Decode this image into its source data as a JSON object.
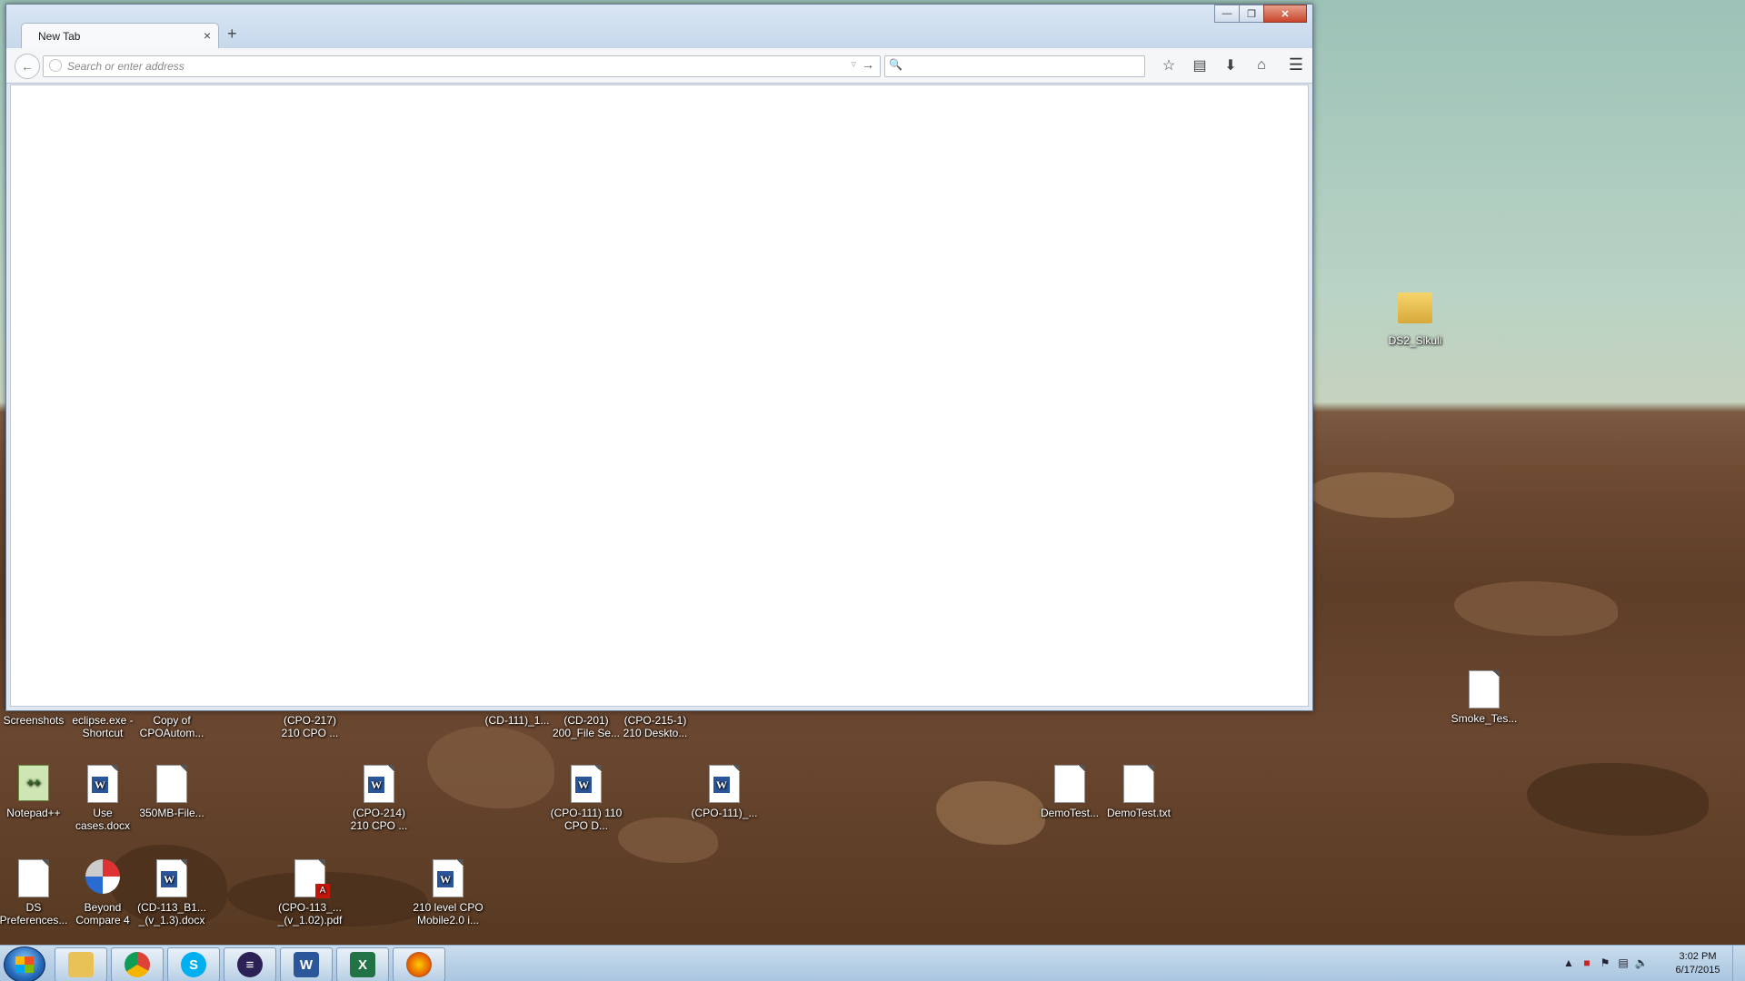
{
  "browser": {
    "tab_title": "New Tab",
    "tab_close": "×",
    "new_tab": "+",
    "url_placeholder": "Search or enter address",
    "search_placeholder": "",
    "window_controls": {
      "minimize": "—",
      "maximize": "❐",
      "close": "✕"
    }
  },
  "desktop_icons": [
    {
      "label": "Screenshots"
    },
    {
      "label": "eclipse.exe - Shortcut"
    },
    {
      "label": "Copy of CPOAutom..."
    },
    {
      "label": "(CPO-217) 210 CPO ..."
    },
    {
      "label": "(CD-111)_1..."
    },
    {
      "label": "(CD-201) 200_File Se..."
    },
    {
      "label": "(CPO-215-1) 210 Deskto..."
    },
    {
      "label": "Notepad++"
    },
    {
      "label": "Use cases.docx"
    },
    {
      "label": "350MB-File..."
    },
    {
      "label": "(CPO-214) 210 CPO ..."
    },
    {
      "label": "(CPO-111) 110 CPO D..."
    },
    {
      "label": "(CPO-111)_..."
    },
    {
      "label": "DemoTest..."
    },
    {
      "label": "DemoTest.txt"
    },
    {
      "label": "DS Preferences..."
    },
    {
      "label": "Beyond Compare 4"
    },
    {
      "label": "(CD-113_B1... _(v_1.3).docx"
    },
    {
      "label": "(CPO-113_... _(v_1.02).pdf"
    },
    {
      "label": "210 level CPO Mobile2.0 i..."
    },
    {
      "label": "DS2_Sikuli"
    },
    {
      "label": "Smoke_Tes..."
    }
  ],
  "taskbar": {
    "apps": [
      "Windows Explorer",
      "Google Chrome",
      "Skype",
      "Eclipse",
      "Microsoft Word",
      "Microsoft Excel",
      "Firefox"
    ],
    "clock_time": "3:02 PM",
    "clock_date": "6/17/2015"
  },
  "colors": {
    "word": "#2b579a",
    "excel": "#217346",
    "firefox": "#e66000",
    "chrome_red": "#db4437",
    "skype": "#00aff0"
  }
}
